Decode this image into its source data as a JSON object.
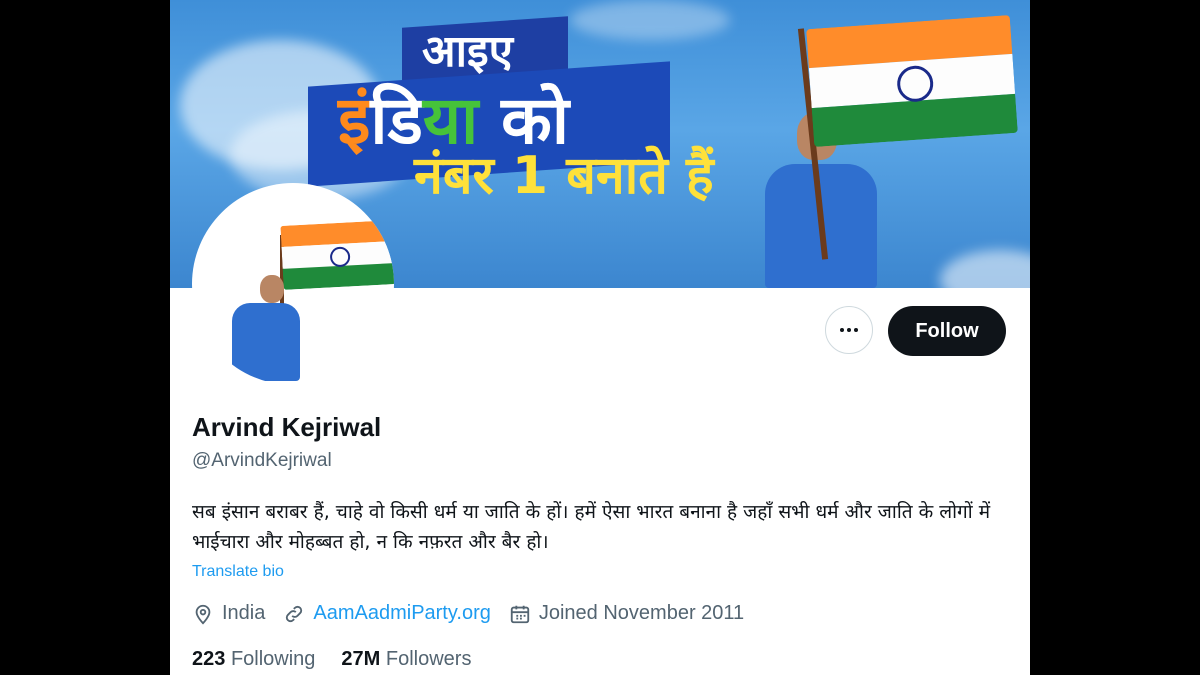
{
  "banner": {
    "line1": "आइए",
    "line2_part1": "इं",
    "line2_part2": "डि",
    "line2_part3": "या",
    "line2_part4": " को",
    "line3": "नंबर 1 बनाते हैं"
  },
  "actions": {
    "more_icon": "more-horizontal-icon",
    "follow_label": "Follow"
  },
  "profile": {
    "name": "Arvind Kejriwal",
    "handle": "@ArvindKejriwal",
    "bio": "सब इंसान बराबर हैं, चाहे वो किसी धर्म या जाति के हों। हमें ऐसा भारत बनाना है जहाँ सभी धर्म और जाति के लोगों में भाईचारा और मोहब्बत हो, न कि नफ़रत और बैर हो।",
    "translate_label": "Translate bio",
    "location": "India",
    "website": "AamAadmiParty.org",
    "joined": "Joined November 2011"
  },
  "stats": {
    "following_count": "223",
    "following_label": "Following",
    "followers_count": "27M",
    "followers_label": "Followers"
  },
  "colors": {
    "link": "#1d9bf0",
    "follow_bg": "#0f1419",
    "secondary_text": "#536471"
  }
}
